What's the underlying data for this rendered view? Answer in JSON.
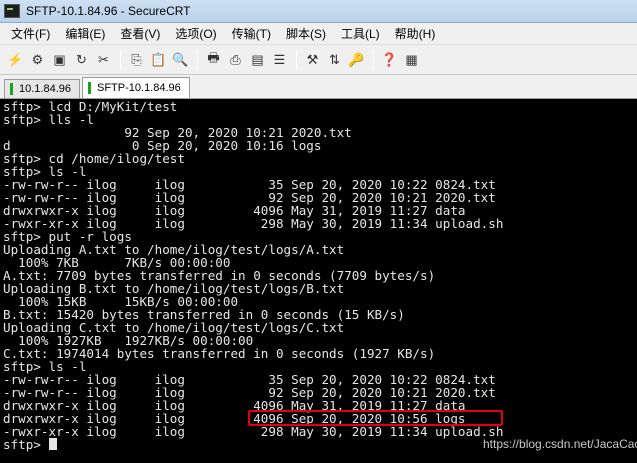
{
  "window": {
    "title": "SFTP-10.1.84.96 - SecureCRT"
  },
  "menu": [
    "文件(F)",
    "编辑(E)",
    "查看(V)",
    "选项(O)",
    "传输(T)",
    "脚本(S)",
    "工具(L)",
    "帮助(H)"
  ],
  "tabs": [
    {
      "label": "10.1.84.96",
      "active": false
    },
    {
      "label": "SFTP-10.1.84.96",
      "active": true
    }
  ],
  "terminal": {
    "lines": [
      "sftp> lcd D:/MyKit/test",
      "sftp> lls -l",
      "                92 Sep 20, 2020 10:21 2020.txt",
      "d                0 Sep 20, 2020 10:16 logs",
      "sftp> cd /home/ilog/test",
      "sftp> ls -l",
      "-rw-rw-r-- ilog     ilog           35 Sep 20, 2020 10:22 0824.txt",
      "-rw-rw-r-- ilog     ilog           92 Sep 20, 2020 10:21 2020.txt",
      "drwxrwxr-x ilog     ilog         4096 May 31, 2019 11:27 data",
      "-rwxr-xr-x ilog     ilog          298 May 30, 2019 11:34 upload.sh",
      "sftp> put -r logs",
      "Uploading A.txt to /home/ilog/test/logs/A.txt",
      "  100% 7KB      7KB/s 00:00:00",
      "A.txt: 7709 bytes transferred in 0 seconds (7709 bytes/s)",
      "Uploading B.txt to /home/ilog/test/logs/B.txt",
      "  100% 15KB     15KB/s 00:00:00",
      "B.txt: 15420 bytes transferred in 0 seconds (15 KB/s)",
      "Uploading C.txt to /home/ilog/test/logs/C.txt",
      "  100% 1927KB   1927KB/s 00:00:00",
      "C.txt: 1974014 bytes transferred in 0 seconds (1927 KB/s)",
      "sftp> ls -l",
      "-rw-rw-r-- ilog     ilog           35 Sep 20, 2020 10:22 0824.txt",
      "-rw-rw-r-- ilog     ilog           92 Sep 20, 2020 10:21 2020.txt",
      "drwxrwxr-x ilog     ilog         4096 May 31, 2019 11:27 data",
      "drwxrwxr-x ilog     ilog         4096 Sep 20, 2020 10:56 logs",
      "-rwxr-xr-x ilog     ilog          298 May 30, 2019 11:34 upload.sh",
      "sftp> "
    ]
  },
  "watermark": "https://blog.csdn.net/JacaCao",
  "colors": {
    "terminal_bg": "#000000",
    "terminal_fg": "#e6e6e6",
    "highlight": "#e0000f",
    "tab_indicator": "#19a319"
  }
}
